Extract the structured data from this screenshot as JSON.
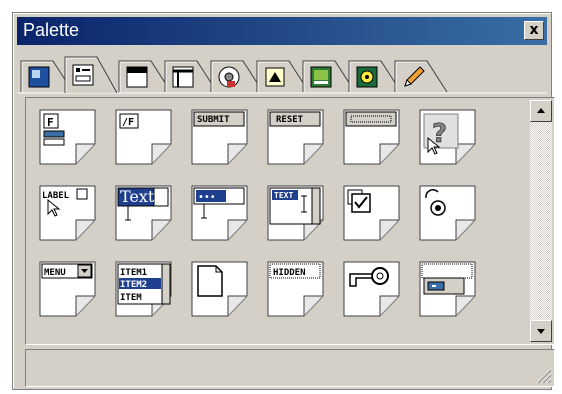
{
  "window": {
    "title": "Palette",
    "close_label": "x"
  },
  "tabs": [
    {
      "name": "tab-common",
      "icon": "common-icon"
    },
    {
      "name": "tab-forms",
      "icon": "forms-icon",
      "selected": true
    },
    {
      "name": "tab-frames",
      "icon": "frames-icon"
    },
    {
      "name": "tab-layout",
      "icon": "layout-icon"
    },
    {
      "name": "tab-media",
      "icon": "media-icon"
    },
    {
      "name": "tab-objects",
      "icon": "objects-icon"
    },
    {
      "name": "tab-images",
      "icon": "images-icon"
    },
    {
      "name": "tab-multimedia",
      "icon": "multimedia-icon"
    },
    {
      "name": "tab-draw",
      "icon": "pencil-icon"
    }
  ],
  "items": {
    "form": "F",
    "end_form": "/F",
    "submit": "SUBMIT",
    "reset": "RESET",
    "label": "LABEL",
    "text": "Text",
    "password": "•••",
    "textarea": "TEXT",
    "menu": "MENU",
    "list_1": "ITEM1",
    "list_2": "ITEM2",
    "list_3": "ITEM",
    "hidden": "HIDDEN"
  }
}
